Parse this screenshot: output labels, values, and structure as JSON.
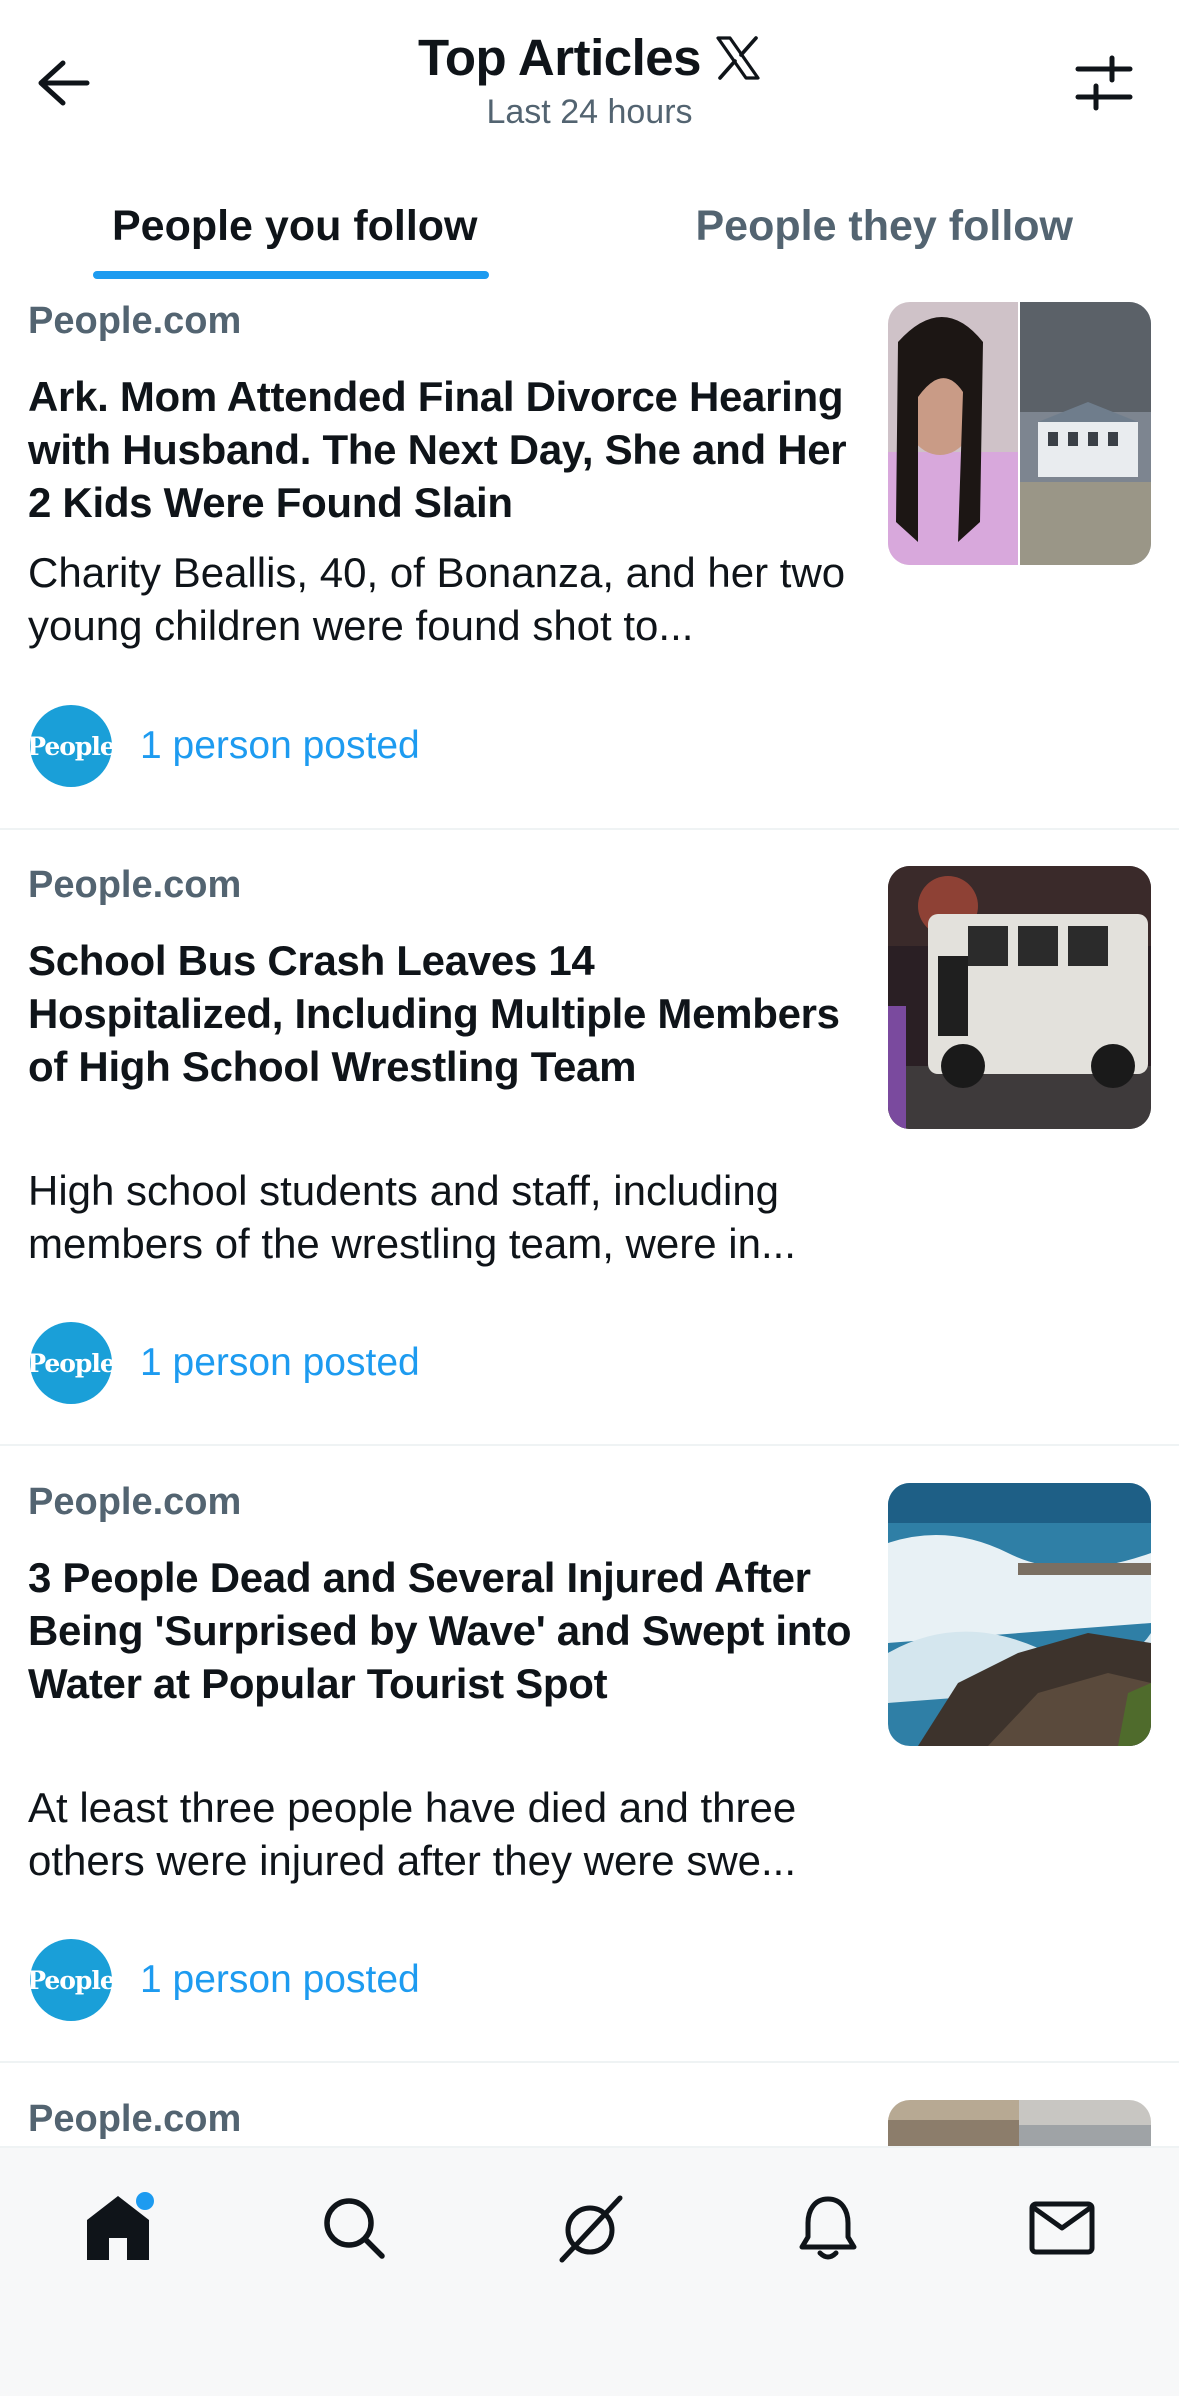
{
  "header": {
    "title": "Top Articles",
    "subtitle": "Last 24 hours",
    "back_icon": "arrow-left-icon",
    "logo_icon": "x-logo-icon",
    "filter_icon": "sliders-icon"
  },
  "tabs": [
    {
      "label": "People you follow",
      "active": true
    },
    {
      "label": "People they follow",
      "active": false
    }
  ],
  "articles": [
    {
      "source": "People.com",
      "headline": "Ark. Mom Attended Final Divorce Hearing with Husband. The Next Day, She and Her 2 Kids Were Found Slain",
      "summary": "Charity Beallis, 40, of Bonanza, and her two young children were found shot to...",
      "avatar_text": "People",
      "posted": "1 person posted"
    },
    {
      "source": "People.com",
      "headline": "School Bus Crash Leaves 14 Hospitalized, Including Multiple Members of High School Wrestling Team",
      "summary": "High school students and staff, including members of the wrestling team, were in...",
      "avatar_text": "People",
      "posted": "1 person posted"
    },
    {
      "source": "People.com",
      "headline": "3 People Dead and Several Injured After Being 'Surprised by Wave' and Swept into Water at Popular Tourist Spot",
      "summary": "At least three people have died and three others were injured after they were swe...",
      "avatar_text": "People",
      "posted": "1 person posted"
    },
    {
      "source": "People.com"
    }
  ],
  "bottom_nav": [
    {
      "icon": "home-icon",
      "active": true
    },
    {
      "icon": "search-icon",
      "active": false
    },
    {
      "icon": "grok-icon",
      "active": false
    },
    {
      "icon": "bell-icon",
      "active": false
    },
    {
      "icon": "mail-icon",
      "active": false
    }
  ],
  "colors": {
    "accent": "#1d9bf0",
    "text_primary": "#0f1419",
    "text_secondary": "#536471"
  }
}
